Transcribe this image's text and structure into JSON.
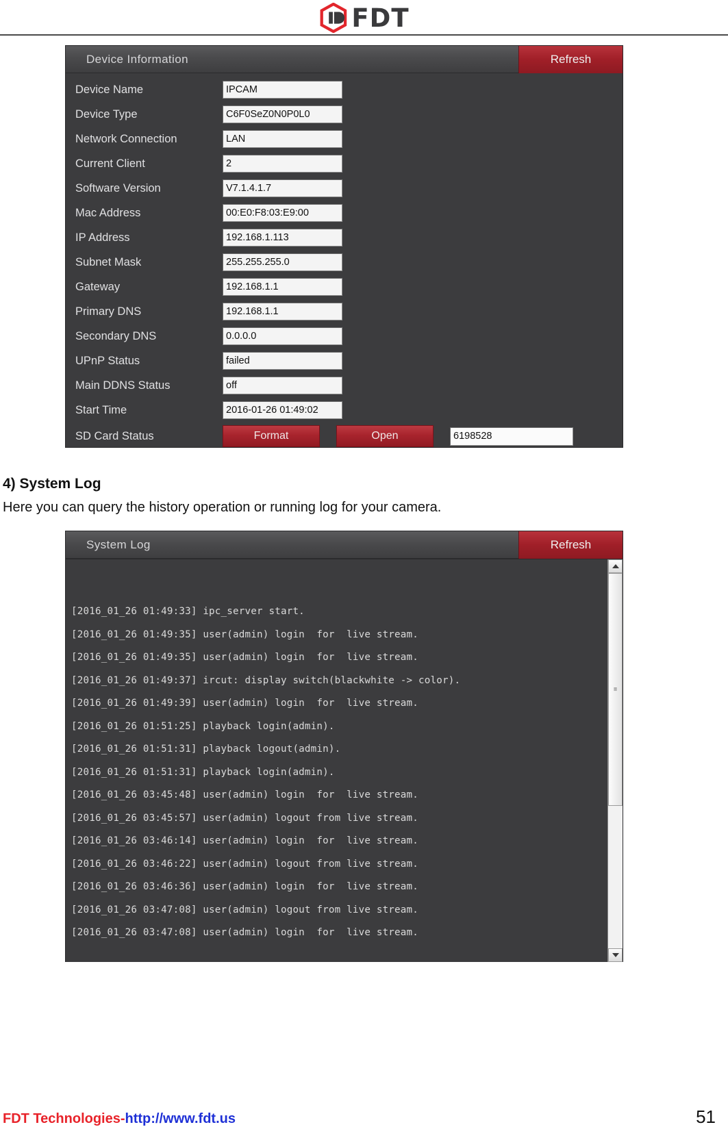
{
  "brand": {
    "name": "FDT",
    "logo_icon": "fdt-hexagon-logo",
    "accent": "#e2262c"
  },
  "device_panel": {
    "title": "Device Information",
    "refresh_label": "Refresh",
    "rows": [
      {
        "label": "Device Name",
        "value": "IPCAM"
      },
      {
        "label": "Device Type",
        "value": "C6F0SeZ0N0P0L0"
      },
      {
        "label": "Network Connection",
        "value": "LAN"
      },
      {
        "label": "Current Client",
        "value": "2"
      },
      {
        "label": "Software Version",
        "value": "V7.1.4.1.7"
      },
      {
        "label": "Mac Address",
        "value": "00:E0:F8:03:E9:00"
      },
      {
        "label": "IP Address",
        "value": "192.168.1.113"
      },
      {
        "label": "Subnet Mask",
        "value": "255.255.255.0"
      },
      {
        "label": "Gateway",
        "value": "192.168.1.1"
      },
      {
        "label": "Primary DNS",
        "value": "192.168.1.1"
      },
      {
        "label": "Secondary DNS",
        "value": "0.0.0.0"
      },
      {
        "label": "UPnP Status",
        "value": "failed"
      },
      {
        "label": "Main DDNS Status",
        "value": "off"
      },
      {
        "label": "Start Time",
        "value": "2016-01-26 01:49:02"
      }
    ],
    "sd_row": {
      "label": "SD Card Status",
      "format_label": "Format",
      "open_label": "Open",
      "size_value": "6198528"
    }
  },
  "section": {
    "heading": "4) System Log",
    "description": "Here you can query the history operation or running log for your camera."
  },
  "log_panel": {
    "title": "System Log",
    "refresh_label": "Refresh",
    "scroll_up_icon": "triangle-up-icon",
    "scroll_down_icon": "triangle-down-icon",
    "lines": [
      "[2016_01_26 01:49:33] ipc_server start.",
      "[2016_01_26 01:49:35] user(admin) login  for  live stream.",
      "[2016_01_26 01:49:35] user(admin) login  for  live stream.",
      "[2016_01_26 01:49:37] ircut: display switch(blackwhite -> color).",
      "[2016_01_26 01:49:39] user(admin) login  for  live stream.",
      "[2016_01_26 01:51:25] playback login(admin).",
      "[2016_01_26 01:51:31] playback logout(admin).",
      "[2016_01_26 01:51:31] playback login(admin).",
      "[2016_01_26 03:45:48] user(admin) login  for  live stream.",
      "[2016_01_26 03:45:57] user(admin) logout from live stream.",
      "[2016_01_26 03:46:14] user(admin) login  for  live stream.",
      "[2016_01_26 03:46:22] user(admin) logout from live stream.",
      "[2016_01_26 03:46:36] user(admin) login  for  live stream.",
      "[2016_01_26 03:47:08] user(admin) logout from live stream.",
      "[2016_01_26 03:47:08] user(admin) login  for  live stream."
    ]
  },
  "footer": {
    "company": "FDT Technologies-",
    "url": "http://www.fdt.us",
    "page_number": "51"
  }
}
